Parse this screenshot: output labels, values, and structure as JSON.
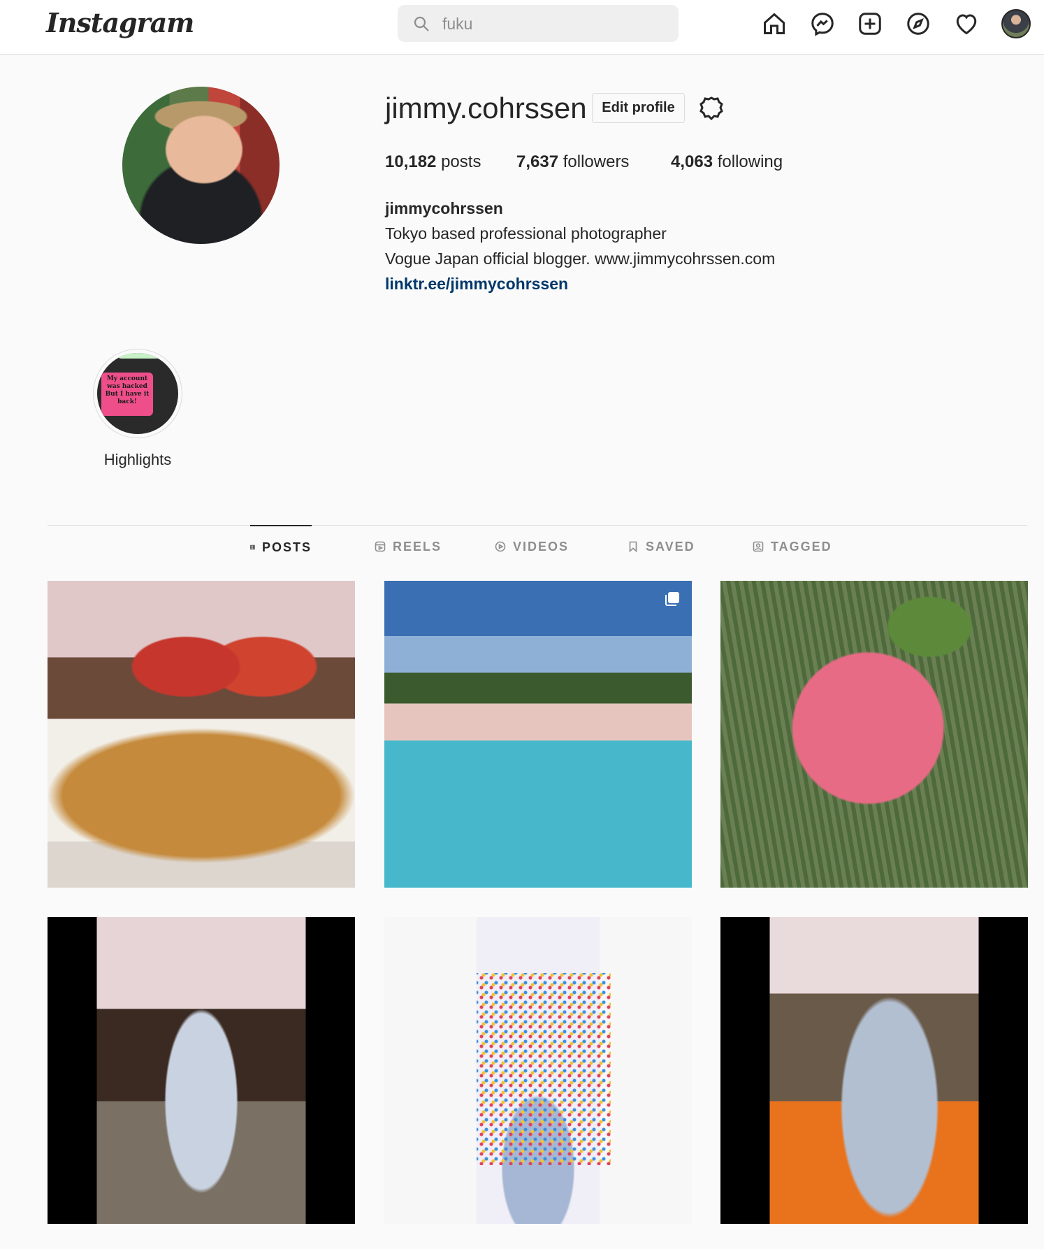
{
  "header": {
    "logo": "Instagram",
    "search": {
      "value": "fuku",
      "placeholder": "Search"
    },
    "nav_icons": [
      "home-icon",
      "messenger-icon",
      "new-post-icon",
      "explore-icon",
      "activity-heart-icon",
      "profile-avatar"
    ]
  },
  "profile": {
    "username": "jimmy.cohrssen",
    "edit_label": "Edit profile",
    "stats": [
      {
        "count": "10,182",
        "label": "posts"
      },
      {
        "count": "7,637",
        "label": "followers"
      },
      {
        "count": "4,063",
        "label": "following"
      }
    ],
    "bio": {
      "name": "jimmycohrssen",
      "lines": [
        "Tokyo based professional photographer",
        "Vogue Japan official blogger. www.jimmycohrssen.com"
      ],
      "link": "linktr.ee/jimmycohrssen"
    }
  },
  "highlights": [
    {
      "label": "Highlights",
      "cover_text": "My account was hacked But I have it back!"
    }
  ],
  "tabs": [
    {
      "label": "POSTS",
      "icon": "grid-icon",
      "active": true
    },
    {
      "label": "REELS",
      "icon": "reels-icon",
      "active": false
    },
    {
      "label": "VIDEOS",
      "icon": "video-icon",
      "active": false
    },
    {
      "label": "SAVED",
      "icon": "bookmark-icon",
      "active": false
    },
    {
      "label": "TAGGED",
      "icon": "tag-person-icon",
      "active": false
    }
  ],
  "posts": [
    {
      "subject": "waffle with strawberry",
      "multi": false
    },
    {
      "subject": "palm trees and swimming pool",
      "multi": true
    },
    {
      "subject": "pink dessert with mint leaf",
      "multi": false
    },
    {
      "subject": "woman in kimono under cherry blossoms",
      "multi": false
    },
    {
      "subject": "woman in kimono before dot painting",
      "multi": false
    },
    {
      "subject": "woman in kimono by orange shrine fence",
      "multi": false
    }
  ]
}
